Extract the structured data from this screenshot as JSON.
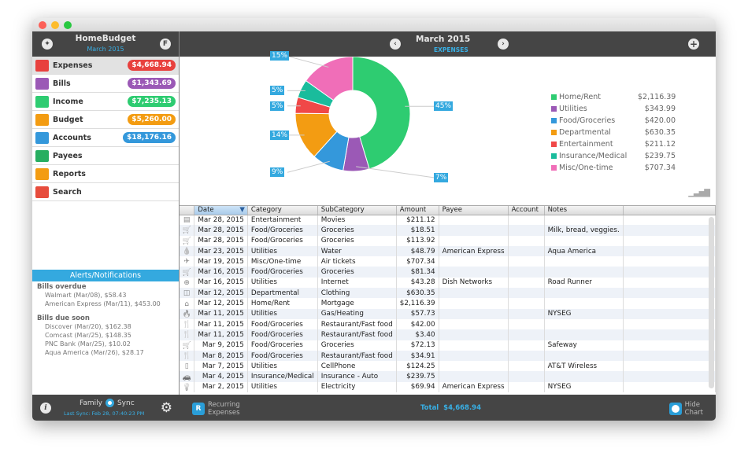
{
  "window": {
    "controls": [
      "close",
      "minimize",
      "maximize"
    ]
  },
  "sidebar": {
    "title": "HomeBudget",
    "subtitle": "March 2015",
    "left_icon": "wrench-icon",
    "right_button": "F",
    "items": [
      {
        "label": "Expenses",
        "badge": "$4,668.94",
        "color": "#e8413e",
        "icon": "wallet-icon",
        "active": true
      },
      {
        "label": "Bills",
        "badge": "$1,343.69",
        "color": "#9b59b6",
        "icon": "calendar-icon"
      },
      {
        "label": "Income",
        "badge": "$7,235.13",
        "color": "#2ecc71",
        "icon": "moneybag-icon"
      },
      {
        "label": "Budget",
        "badge": "$5,260.00",
        "color": "#f39c12",
        "icon": "folder-icon"
      },
      {
        "label": "Accounts",
        "badge": "$18,176.16",
        "color": "#3498db",
        "icon": "accounts-icon"
      },
      {
        "label": "Payees",
        "badge": "",
        "color": "#27ae60",
        "icon": "people-icon"
      },
      {
        "label": "Reports",
        "badge": "",
        "color": "#f39c12",
        "icon": "chart-board-icon"
      },
      {
        "label": "Search",
        "badge": "",
        "color": "#e74c3c",
        "icon": "magnifier-icon"
      }
    ],
    "alerts": {
      "header": "Alerts/Notifications",
      "sections": [
        {
          "title": "Bills overdue",
          "items": [
            "Walmart (Mar/08), $58.43",
            "American Express (Mar/11), $453.00"
          ]
        },
        {
          "title": "Bills due soon",
          "items": [
            "Discover (Mar/20), $162.38",
            "Comcast (Mar/25), $148.35",
            "PNC Bank (Mar/25), $10.02",
            "Aqua America (Mar/26), $28.17"
          ]
        }
      ]
    },
    "footer": {
      "family": "Family",
      "sync": "Sync",
      "last_sync": "Last Sync: Feb 28, 07:40:23 PM"
    }
  },
  "header": {
    "title": "March 2015",
    "subtitle": "EXPENSES"
  },
  "chart_data": {
    "type": "pie",
    "title": "",
    "categories": [
      "Home/Rent",
      "Utilities",
      "Food/Groceries",
      "Departmental",
      "Entertainment",
      "Insurance/Medical",
      "Misc/One-time"
    ],
    "values": [
      2116.39,
      343.99,
      420.0,
      630.35,
      211.12,
      239.75,
      707.34
    ],
    "value_labels": [
      "$2,116.39",
      "$343.99",
      "$420.00",
      "$630.35",
      "$211.12",
      "$239.75",
      "$707.34"
    ],
    "percent_labels": [
      "45%",
      "7%",
      "9%",
      "14%",
      "5%",
      "5%",
      "15%"
    ],
    "colors": [
      "#2ecc71",
      "#9b59b6",
      "#3498db",
      "#f39c12",
      "#f04848",
      "#1abc9c",
      "#f06eb8"
    ],
    "donut": true,
    "legend": "right"
  },
  "table": {
    "columns": [
      "",
      "Date",
      "Category",
      "SubCategory",
      "Amount",
      "Payee",
      "Account",
      "Notes",
      ""
    ],
    "rows": [
      {
        "icon": "film-icon",
        "glyph": "▤",
        "date": "Mar 28, 2015",
        "category": "Entertainment",
        "sub": "Movies",
        "amount": "$211.12",
        "payee": "",
        "account": "",
        "notes": ""
      },
      {
        "icon": "cart-icon",
        "glyph": "🛒",
        "date": "Mar 28, 2015",
        "category": "Food/Groceries",
        "sub": "Groceries",
        "amount": "$18.51",
        "payee": "",
        "account": "",
        "notes": "Milk, bread, veggies."
      },
      {
        "icon": "cart-icon",
        "glyph": "🛒",
        "date": "Mar 28, 2015",
        "category": "Food/Groceries",
        "sub": "Groceries",
        "amount": "$113.92",
        "payee": "",
        "account": "",
        "notes": ""
      },
      {
        "icon": "water-drop-icon",
        "glyph": "💧",
        "date": "Mar 23, 2015",
        "category": "Utilities",
        "sub": "Water",
        "amount": "$48.79",
        "payee": "American Express",
        "account": "",
        "notes": "Aqua America"
      },
      {
        "icon": "airplane-icon",
        "glyph": "✈",
        "date": "Mar 19, 2015",
        "category": "Misc/One-time",
        "sub": "Air tickets",
        "amount": "$707.34",
        "payee": "",
        "account": "",
        "notes": ""
      },
      {
        "icon": "cart-icon",
        "glyph": "🛒",
        "date": "Mar 16, 2015",
        "category": "Food/Groceries",
        "sub": "Groceries",
        "amount": "$81.34",
        "payee": "",
        "account": "",
        "notes": ""
      },
      {
        "icon": "globe-icon",
        "glyph": "⊕",
        "date": "Mar 16, 2015",
        "category": "Utilities",
        "sub": "Internet",
        "amount": "$43.28",
        "payee": "Dish Networks",
        "account": "",
        "notes": "Road Runner"
      },
      {
        "icon": "shirt-icon",
        "glyph": "◫",
        "date": "Mar 12, 2015",
        "category": "Departmental",
        "sub": "Clothing",
        "amount": "$630.35",
        "payee": "",
        "account": "",
        "notes": ""
      },
      {
        "icon": "house-icon",
        "glyph": "⌂",
        "date": "Mar 12, 2015",
        "category": "Home/Rent",
        "sub": "Mortgage",
        "amount": "$2,116.39",
        "payee": "",
        "account": "",
        "notes": ""
      },
      {
        "icon": "flame-icon",
        "glyph": "🔥",
        "date": "Mar 11, 2015",
        "category": "Utilities",
        "sub": "Gas/Heating",
        "amount": "$57.73",
        "payee": "",
        "account": "",
        "notes": "NYSEG"
      },
      {
        "icon": "fork-knife-icon",
        "glyph": "🍴",
        "date": "Mar 11, 2015",
        "category": "Food/Groceries",
        "sub": "Restaurant/Fast food",
        "amount": "$42.00",
        "payee": "",
        "account": "",
        "notes": ""
      },
      {
        "icon": "fork-knife-icon",
        "glyph": "🍴",
        "date": "Mar 11, 2015",
        "category": "Food/Groceries",
        "sub": "Restaurant/Fast food",
        "amount": "$3.40",
        "payee": "",
        "account": "",
        "notes": ""
      },
      {
        "icon": "cart-icon",
        "glyph": "🛒",
        "date": "Mar 9, 2015",
        "category": "Food/Groceries",
        "sub": "Groceries",
        "amount": "$72.13",
        "payee": "",
        "account": "",
        "notes": "Safeway"
      },
      {
        "icon": "fork-knife-icon",
        "glyph": "🍴",
        "date": "Mar 8, 2015",
        "category": "Food/Groceries",
        "sub": "Restaurant/Fast food",
        "amount": "$34.91",
        "payee": "",
        "account": "",
        "notes": ""
      },
      {
        "icon": "cellphone-icon",
        "glyph": "▯",
        "date": "Mar 7, 2015",
        "category": "Utilities",
        "sub": "CellPhone",
        "amount": "$124.25",
        "payee": "",
        "account": "",
        "notes": "AT&T Wireless"
      },
      {
        "icon": "car-icon",
        "glyph": "🚗",
        "date": "Mar 4, 2015",
        "category": "Insurance/Medical",
        "sub": "Insurance - Auto",
        "amount": "$239.75",
        "payee": "",
        "account": "",
        "notes": ""
      },
      {
        "icon": "lightbulb-icon",
        "glyph": "💡",
        "date": "Mar 2, 2015",
        "category": "Utilities",
        "sub": "Electricity",
        "amount": "$69.94",
        "payee": "American Express",
        "account": "",
        "notes": "NYSEG"
      }
    ]
  },
  "footer": {
    "recurring_label_1": "Recurring",
    "recurring_label_2": "Expenses",
    "recurring_badge": "R",
    "total_label": "Total",
    "total_value": "$4,668.94",
    "hide_chart_1": "Hide",
    "hide_chart_2": "Chart"
  }
}
